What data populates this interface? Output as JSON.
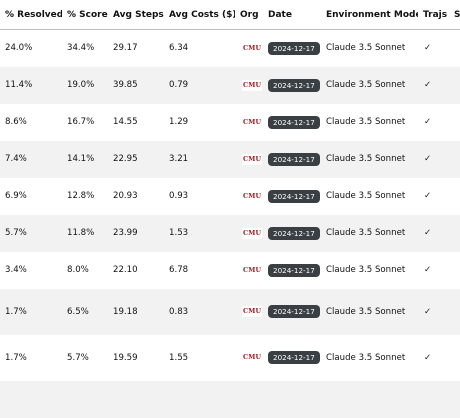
{
  "table": {
    "headers": {
      "resolved": "% Resolved",
      "score": "% Score",
      "steps": "Avg Steps",
      "costs": "Avg Costs ($)",
      "org": "Org",
      "date": "Date",
      "env": "Environment Model",
      "trajs": "Trajs",
      "extra": "S"
    },
    "rows": [
      {
        "resolved": "24.0%",
        "score": "34.4%",
        "steps": "29.17",
        "costs": "6.34",
        "org": "CMU",
        "date": "2024-12-17",
        "env": "Claude 3.5 Sonnet",
        "trajs": "✓"
      },
      {
        "resolved": "11.4%",
        "score": "19.0%",
        "steps": "39.85",
        "costs": "0.79",
        "org": "CMU",
        "date": "2024-12-17",
        "env": "Claude 3.5 Sonnet",
        "trajs": "✓"
      },
      {
        "resolved": "8.6%",
        "score": "16.7%",
        "steps": "14.55",
        "costs": "1.29",
        "org": "CMU",
        "date": "2024-12-17",
        "env": "Claude 3.5 Sonnet",
        "trajs": "✓"
      },
      {
        "resolved": "7.4%",
        "score": "14.1%",
        "steps": "22.95",
        "costs": "3.21",
        "org": "CMU",
        "date": "2024-12-17",
        "env": "Claude 3.5 Sonnet",
        "trajs": "✓"
      },
      {
        "resolved": "6.9%",
        "score": "12.8%",
        "steps": "20.93",
        "costs": "0.93",
        "org": "CMU",
        "date": "2024-12-17",
        "env": "Claude 3.5 Sonnet",
        "trajs": "✓"
      },
      {
        "resolved": "5.7%",
        "score": "11.8%",
        "steps": "23.99",
        "costs": "1.53",
        "org": "CMU",
        "date": "2024-12-17",
        "env": "Claude 3.5 Sonnet",
        "trajs": "✓"
      },
      {
        "resolved": "3.4%",
        "score": "8.0%",
        "steps": "22.10",
        "costs": "6.78",
        "org": "CMU",
        "date": "2024-12-17",
        "env": "Claude 3.5 Sonnet",
        "trajs": "✓"
      },
      {
        "resolved": "1.7%",
        "score": "6.5%",
        "steps": "19.18",
        "costs": "0.83",
        "org": "CMU",
        "date": "2024-12-17",
        "env": "Claude 3.5 Sonnet",
        "trajs": "✓"
      },
      {
        "resolved": "1.7%",
        "score": "5.7%",
        "steps": "19.59",
        "costs": "1.55",
        "org": "CMU",
        "date": "2024-12-17",
        "env": "Claude 3.5 Sonnet",
        "trajs": "✓"
      }
    ]
  },
  "colors": {
    "logo": "#9c1a22",
    "date_badge_bg": "#3a3f44",
    "stripe": "#f2f2f2"
  },
  "icons": {
    "org_logo": "cmu-logo",
    "trajs": "checkmark-icon"
  }
}
